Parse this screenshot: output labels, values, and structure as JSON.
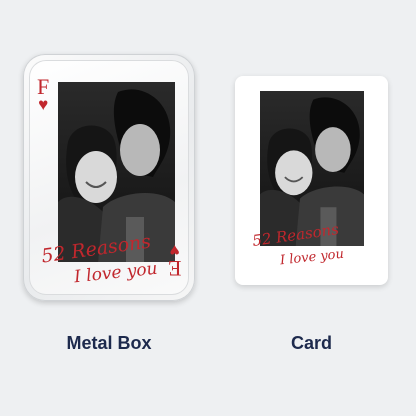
{
  "products": {
    "metal_box": {
      "label": "Metal Box",
      "card_rank": "F",
      "card_rank_inverted": "E",
      "suit_symbol": "♥",
      "script_line1": "52 Reasons",
      "script_line2": "I love you"
    },
    "card": {
      "label": "Card",
      "script_line1": "52 Reasons",
      "script_line2": "I love you"
    }
  },
  "colors": {
    "background": "#eef0f2",
    "accent_red": "#c1272d",
    "label_navy": "#1d2a4d"
  }
}
